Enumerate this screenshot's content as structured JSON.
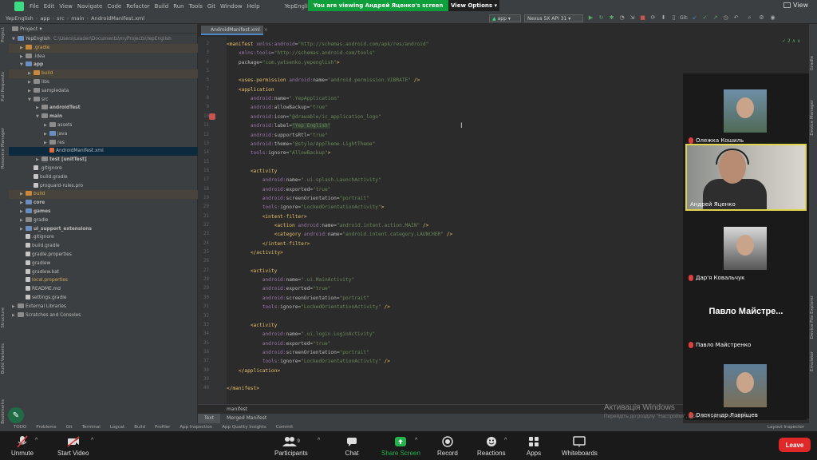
{
  "menu": [
    "File",
    "Edit",
    "View",
    "Navigate",
    "Code",
    "Refactor",
    "Build",
    "Run",
    "Tools",
    "Git",
    "Window",
    "Help"
  ],
  "window_title": "YepEnglish - AndroidManifest...",
  "share_banner": "You are viewing Андрей Яценко's screen",
  "view_options": "View Options",
  "top_right_view": "View",
  "breadcrumbs": [
    "YepEnglish",
    "app",
    "src",
    "main",
    "AndroidManifest.xml"
  ],
  "run_config": "app",
  "device": "Nexus 5X API 31",
  "git_label": "Git:",
  "project_panel": {
    "title": "Project",
    "tree": [
      {
        "label": "YepEnglish",
        "note": "C:\\Users\\Leader\\Documents\\myProjects\\YepEnglish",
        "depth": 0,
        "icon": "folder mod",
        "open": true
      },
      {
        "label": ".gradle",
        "depth": 1,
        "icon": "folder orange",
        "excluded": true
      },
      {
        "label": ".idea",
        "depth": 1,
        "icon": "folder"
      },
      {
        "label": "app",
        "depth": 1,
        "icon": "folder mod",
        "open": true,
        "bold": true
      },
      {
        "label": "build",
        "depth": 2,
        "icon": "folder orange",
        "excluded": true
      },
      {
        "label": "libs",
        "depth": 2,
        "icon": "folder"
      },
      {
        "label": "sampledata",
        "depth": 2,
        "icon": "folder"
      },
      {
        "label": "src",
        "depth": 2,
        "icon": "folder",
        "open": true
      },
      {
        "label": "androidTest",
        "depth": 3,
        "icon": "folder",
        "bold": true
      },
      {
        "label": "main",
        "depth": 3,
        "icon": "folder",
        "open": true,
        "bold": true
      },
      {
        "label": "assets",
        "depth": 4,
        "icon": "folder"
      },
      {
        "label": "java",
        "depth": 4,
        "icon": "folder mod"
      },
      {
        "label": "res",
        "depth": 4,
        "icon": "folder"
      },
      {
        "label": "AndroidManifest.xml",
        "depth": 4,
        "icon": "file xml",
        "selected": true
      },
      {
        "label": "test [unitTest]",
        "depth": 3,
        "icon": "folder",
        "bold": true
      },
      {
        "label": ".gitignore",
        "depth": 2,
        "icon": "file"
      },
      {
        "label": "build.gradle",
        "depth": 2,
        "icon": "file"
      },
      {
        "label": "proguard-rules.pro",
        "depth": 2,
        "icon": "file"
      },
      {
        "label": "build",
        "depth": 1,
        "icon": "folder orange",
        "excluded": true
      },
      {
        "label": "core",
        "depth": 1,
        "icon": "folder mod",
        "bold": true
      },
      {
        "label": "games",
        "depth": 1,
        "icon": "folder mod",
        "bold": true
      },
      {
        "label": "gradle",
        "depth": 1,
        "icon": "folder"
      },
      {
        "label": "ui_support_extensions",
        "depth": 1,
        "icon": "folder mod",
        "bold": true
      },
      {
        "label": ".gitignore",
        "depth": 1,
        "icon": "file"
      },
      {
        "label": "build.gradle",
        "depth": 1,
        "icon": "file"
      },
      {
        "label": "gradle.properties",
        "depth": 1,
        "icon": "file"
      },
      {
        "label": "gradlew",
        "depth": 1,
        "icon": "file"
      },
      {
        "label": "gradlew.bat",
        "depth": 1,
        "icon": "file"
      },
      {
        "label": "local.properties",
        "depth": 1,
        "icon": "file",
        "orange": true
      },
      {
        "label": "README.md",
        "depth": 1,
        "icon": "file"
      },
      {
        "label": "settings.gradle",
        "depth": 1,
        "icon": "file"
      },
      {
        "label": "External Libraries",
        "depth": 0,
        "icon": "folder"
      },
      {
        "label": "Scratches and Consoles",
        "depth": 0,
        "icon": "folder"
      }
    ]
  },
  "left_strip_labels": [
    "Project",
    "Pull Requests",
    "Resource Manager",
    "Structure",
    "Build Variants",
    "Bookmarks"
  ],
  "right_strip_labels": [
    "Gradle",
    "Device Manager",
    "Device File Explorer",
    "Emulator"
  ],
  "editor": {
    "tab": "AndroidManifest.xml",
    "inspection_count": "2",
    "lines": [
      {
        "n": "2",
        "t": [
          [
            "kw",
            "<manifest "
          ],
          [
            "ns",
            "xmlns:android"
          ],
          [
            "at",
            "="
          ],
          [
            "str",
            "\"http://schemas.android.com/apk/res/android\""
          ]
        ]
      },
      {
        "n": "3",
        "t": [
          [
            "at",
            "    "
          ],
          [
            "ns",
            "xmlns:tools"
          ],
          [
            "at",
            "="
          ],
          [
            "str",
            "\"http://schemas.android.com/tools\""
          ]
        ]
      },
      {
        "n": "4",
        "t": [
          [
            "at",
            "    package="
          ],
          [
            "str",
            "\"com.yatsenko.yepenglish\""
          ],
          [
            "kw",
            ">"
          ]
        ]
      },
      {
        "n": "5",
        "t": []
      },
      {
        "n": "6",
        "t": [
          [
            "at",
            "    "
          ],
          [
            "kw",
            "<uses-permission "
          ],
          [
            "ns",
            "android:"
          ],
          [
            "at",
            "name="
          ],
          [
            "str",
            "\"android.permission.VIBRATE\""
          ],
          [
            "kw",
            " />"
          ]
        ]
      },
      {
        "n": "7",
        "t": [
          [
            "at",
            "    "
          ],
          [
            "kw",
            "<application"
          ]
        ]
      },
      {
        "n": "8",
        "t": [
          [
            "at",
            "        "
          ],
          [
            "ns",
            "android:"
          ],
          [
            "at",
            "name="
          ],
          [
            "str",
            "\".YepApplication\""
          ]
        ]
      },
      {
        "n": "9",
        "t": [
          [
            "at",
            "        "
          ],
          [
            "ns",
            "android:"
          ],
          [
            "at",
            "allowBackup="
          ],
          [
            "str",
            "\"true\""
          ]
        ]
      },
      {
        "n": "10",
        "t": [
          [
            "at",
            "        "
          ],
          [
            "ns",
            "android:"
          ],
          [
            "at",
            "icon="
          ],
          [
            "str",
            "\"@drawable/ic_application_logo\""
          ]
        ]
      },
      {
        "n": "11",
        "t": [
          [
            "at",
            "        "
          ],
          [
            "ns",
            "android:"
          ],
          [
            "at",
            "label="
          ],
          [
            "str",
            "\"Yep English\""
          ]
        ],
        "hl": true
      },
      {
        "n": "12",
        "t": [
          [
            "at",
            "        "
          ],
          [
            "ns",
            "android:"
          ],
          [
            "at",
            "supportsRtl="
          ],
          [
            "str",
            "\"true\""
          ]
        ]
      },
      {
        "n": "13",
        "t": [
          [
            "at",
            "        "
          ],
          [
            "ns",
            "android:"
          ],
          [
            "at",
            "theme="
          ],
          [
            "str",
            "\"@style/AppTheme.LightTheme\""
          ]
        ]
      },
      {
        "n": "14",
        "t": [
          [
            "at",
            "        "
          ],
          [
            "ns",
            "tools:"
          ],
          [
            "at",
            "ignore="
          ],
          [
            "str",
            "\"AllowBackup\""
          ],
          [
            "kw",
            ">"
          ]
        ]
      },
      {
        "n": "15",
        "t": []
      },
      {
        "n": "16",
        "t": [
          [
            "at",
            "        "
          ],
          [
            "kw",
            "<activity"
          ]
        ]
      },
      {
        "n": "17",
        "t": [
          [
            "at",
            "            "
          ],
          [
            "ns",
            "android:"
          ],
          [
            "at",
            "name="
          ],
          [
            "str",
            "\".ui.splash.LaunchActivity\""
          ]
        ]
      },
      {
        "n": "18",
        "t": [
          [
            "at",
            "            "
          ],
          [
            "ns",
            "android:"
          ],
          [
            "at",
            "exported="
          ],
          [
            "str",
            "\"true\""
          ]
        ]
      },
      {
        "n": "19",
        "t": [
          [
            "at",
            "            "
          ],
          [
            "ns",
            "android:"
          ],
          [
            "at",
            "screenOrientation="
          ],
          [
            "str",
            "\"portrait\""
          ]
        ]
      },
      {
        "n": "20",
        "t": [
          [
            "at",
            "            "
          ],
          [
            "ns",
            "tools:"
          ],
          [
            "at",
            "ignore="
          ],
          [
            "str",
            "\"LockedOrientationActivity\""
          ],
          [
            "kw",
            ">"
          ]
        ]
      },
      {
        "n": "21",
        "t": [
          [
            "at",
            "            "
          ],
          [
            "kw",
            "<intent-filter>"
          ]
        ]
      },
      {
        "n": "22",
        "t": [
          [
            "at",
            "                "
          ],
          [
            "kw",
            "<action "
          ],
          [
            "ns",
            "android:"
          ],
          [
            "at",
            "name="
          ],
          [
            "str",
            "\"android.intent.action.MAIN\""
          ],
          [
            "kw",
            " />"
          ]
        ]
      },
      {
        "n": "23",
        "t": [
          [
            "at",
            "                "
          ],
          [
            "kw",
            "<category "
          ],
          [
            "ns",
            "android:"
          ],
          [
            "at",
            "name="
          ],
          [
            "str",
            "\"android.intent.category.LAUNCHER\""
          ],
          [
            "kw",
            " />"
          ]
        ]
      },
      {
        "n": "24",
        "t": [
          [
            "at",
            "            "
          ],
          [
            "kw",
            "</intent-filter>"
          ]
        ]
      },
      {
        "n": "25",
        "t": [
          [
            "at",
            "        "
          ],
          [
            "kw",
            "</activity>"
          ]
        ]
      },
      {
        "n": "26",
        "t": []
      },
      {
        "n": "27",
        "t": [
          [
            "at",
            "        "
          ],
          [
            "kw",
            "<activity"
          ]
        ]
      },
      {
        "n": "28",
        "t": [
          [
            "at",
            "            "
          ],
          [
            "ns",
            "android:"
          ],
          [
            "at",
            "name="
          ],
          [
            "str",
            "\".ui.MainActivity\""
          ]
        ]
      },
      {
        "n": "29",
        "t": [
          [
            "at",
            "            "
          ],
          [
            "ns",
            "android:"
          ],
          [
            "at",
            "exported="
          ],
          [
            "str",
            "\"true\""
          ]
        ]
      },
      {
        "n": "30",
        "t": [
          [
            "at",
            "            "
          ],
          [
            "ns",
            "android:"
          ],
          [
            "at",
            "screenOrientation="
          ],
          [
            "str",
            "\"portrait\""
          ]
        ]
      },
      {
        "n": "31",
        "t": [
          [
            "at",
            "            "
          ],
          [
            "ns",
            "tools:"
          ],
          [
            "at",
            "ignore="
          ],
          [
            "str",
            "\"LockedOrientationActivity\""
          ],
          [
            "kw",
            " />"
          ]
        ]
      },
      {
        "n": "32",
        "t": []
      },
      {
        "n": "33",
        "t": [
          [
            "at",
            "        "
          ],
          [
            "kw",
            "<activity"
          ]
        ]
      },
      {
        "n": "34",
        "t": [
          [
            "at",
            "            "
          ],
          [
            "ns",
            "android:"
          ],
          [
            "at",
            "name="
          ],
          [
            "str",
            "\".ui.login.LoginActivity\""
          ]
        ]
      },
      {
        "n": "35",
        "t": [
          [
            "at",
            "            "
          ],
          [
            "ns",
            "android:"
          ],
          [
            "at",
            "exported="
          ],
          [
            "str",
            "\"true\""
          ]
        ]
      },
      {
        "n": "36",
        "t": [
          [
            "at",
            "            "
          ],
          [
            "ns",
            "android:"
          ],
          [
            "at",
            "screenOrientation="
          ],
          [
            "str",
            "\"portrait\""
          ]
        ]
      },
      {
        "n": "37",
        "t": [
          [
            "at",
            "            "
          ],
          [
            "ns",
            "tools:"
          ],
          [
            "at",
            "ignore="
          ],
          [
            "str",
            "\"LockedOrientationActivity\""
          ],
          [
            "kw",
            " />"
          ]
        ]
      },
      {
        "n": "38",
        "t": [
          [
            "at",
            "    "
          ],
          [
            "kw",
            "</application>"
          ]
        ]
      },
      {
        "n": "39",
        "t": []
      },
      {
        "n": "40",
        "t": [
          [
            "kw",
            "</manifest>"
          ]
        ]
      }
    ],
    "breadcrumb_bottom": "manifest",
    "bottom_tabs": [
      "Text",
      "Merged Manifest"
    ]
  },
  "bottom_tools": [
    "TODO",
    "Problems",
    "Git",
    "Terminal",
    "Logcat",
    "Build",
    "Profiler",
    "App Inspection",
    "App Quality Insights",
    "Commit",
    "Layout Inspector"
  ],
  "participants": [
    {
      "name": "Олежка Кошиль",
      "type": "photo",
      "active": false
    },
    {
      "name": "Андрей Яценко",
      "type": "video",
      "active": true
    },
    {
      "name": "Дар'я Ковальчук",
      "type": "photo",
      "active": false
    },
    {
      "name": "Павло Майстренко",
      "type": "text",
      "display": "Павло  Майстре...",
      "active": false
    },
    {
      "name": "Олександр Лаврiщев",
      "type": "photo",
      "active": false
    }
  ],
  "watermark": {
    "title": "Активація Windows",
    "subtitle": "Перейдіть до розділу \"Настройки\", щоб активувати Windows."
  },
  "zoom": {
    "unmute": "Unmute",
    "start_video": "Start Video",
    "participants": "Participants",
    "participants_count": "9",
    "chat": "Chat",
    "share_screen": "Share Screen",
    "record": "Record",
    "reactions": "Reactions",
    "apps": "Apps",
    "whiteboards": "Whiteboards",
    "leave": "Leave"
  },
  "colors": {
    "share_green": "#0e9f3b",
    "leave_red": "#e02828",
    "active_tile": "#e0d24a"
  }
}
